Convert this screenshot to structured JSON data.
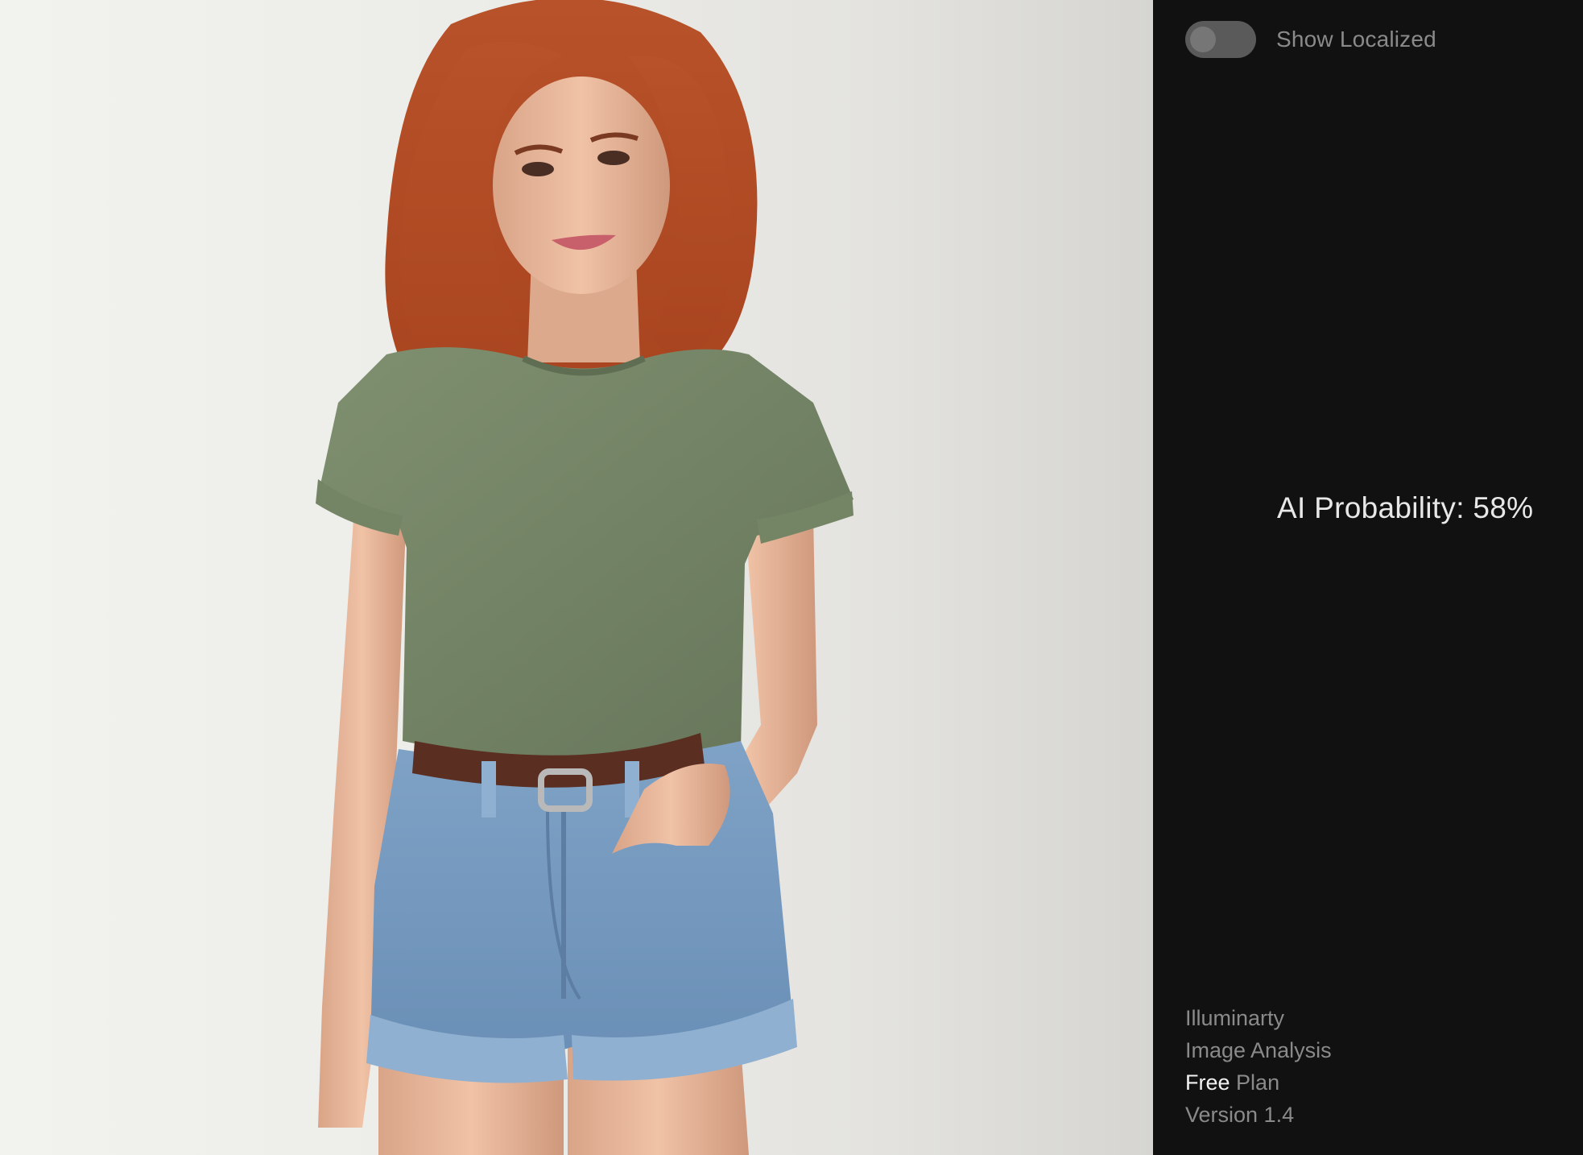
{
  "sidebar": {
    "toggle": {
      "label": "Show Localized",
      "enabled": false
    },
    "result": {
      "text": "AI Probability: 58%",
      "value_percent": 58
    },
    "footer": {
      "app_name": "Illuminarty",
      "subtitle": "Image Analysis",
      "plan_strong": "Free",
      "plan_rest": "Plan",
      "version": "Version 1.4"
    }
  },
  "colors": {
    "sidebar_bg": "#111111",
    "toggle_track": "#5a5a5a",
    "muted_text": "#8a8a8a",
    "bright_text": "#e8e8e8"
  }
}
